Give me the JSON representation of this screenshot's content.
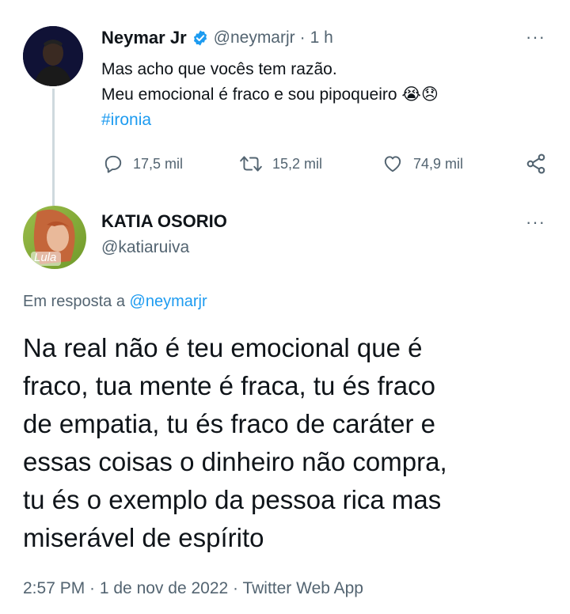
{
  "tweet": {
    "author_name": "Neymar Jr",
    "author_handle": "@neymarjr",
    "time": "1 h",
    "separator": "·",
    "line1": "Mas acho que vocês tem razão.",
    "line2": "Meu emocional é fraco e sou pipoqueiro",
    "emoji1": "😭",
    "emoji2": "😞",
    "hashtag": "#ironia",
    "stats": {
      "replies": "17,5 mil",
      "retweets": "15,2 mil",
      "likes": "74,9 mil"
    },
    "more": "···"
  },
  "reply": {
    "author_name": "KATIA OSORIO",
    "author_handle": "@katiaruiva",
    "avatar_text": "Lula",
    "more": "···",
    "in_reply_prefix": "Em resposta a",
    "in_reply_handle": "@neymarjr",
    "lines": [
      "Na real não é teu emocional que é",
      "fraco, tua mente é fraca, tu és fraco",
      "de empatia, tu és fraco de caráter e",
      "essas coisas o dinheiro não compra,",
      "tu és o exemplo da pessoa rica mas",
      "miserável de espírito"
    ],
    "footer": "2:57 PM · 1 de nov de 2022 · Twitter Web App"
  },
  "colors": {
    "accent": "#1d9bf0",
    "muted": "#536471",
    "text": "#0f1419",
    "divider": "#cfd9de"
  }
}
